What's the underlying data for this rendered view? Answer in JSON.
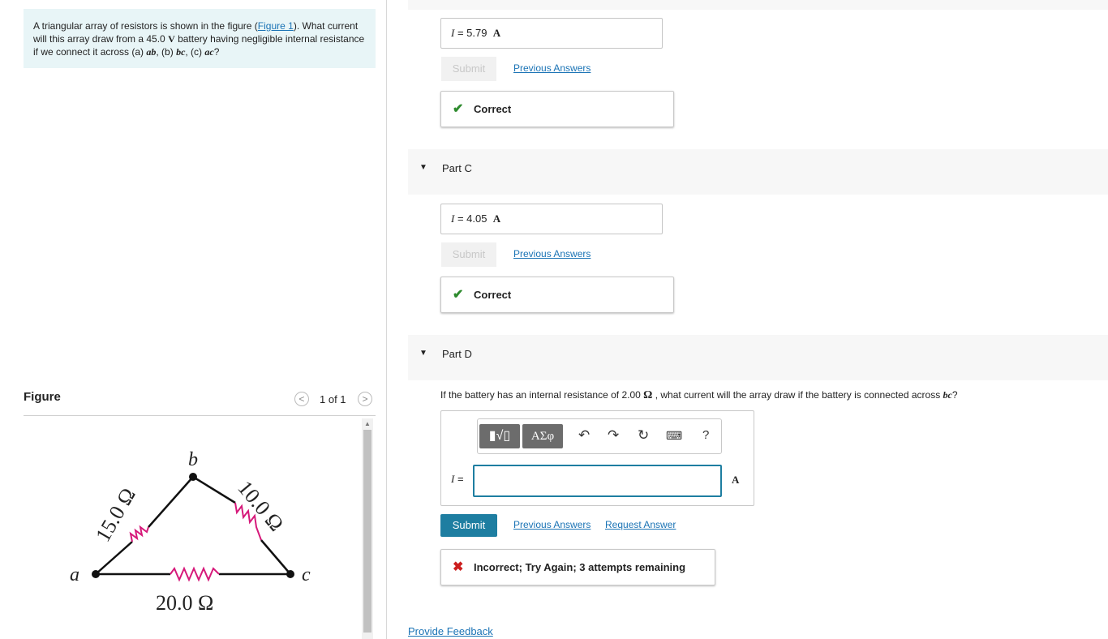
{
  "problem": {
    "text_1": "A triangular array of resistors is shown in the figure (",
    "figure_link": "Figure 1",
    "text_2": "). What current will this array draw from a 45.0 ",
    "unit_v": "V",
    "text_3": " battery having negligible internal resistance if we connect it across (a) ",
    "ab": "ab",
    "text_4": ", (b) ",
    "bc": "bc",
    "text_5": ", (c) ",
    "ac": "ac",
    "text_6": "?"
  },
  "figure": {
    "title": "Figure",
    "pager": "1 of 1",
    "prev": "<",
    "next": ">",
    "node_a": "a",
    "node_b": "b",
    "node_c": "c",
    "r_ab": "15.0 Ω",
    "r_bc": "10.0 Ω",
    "r_ac": "20.0 Ω",
    "colors": {
      "resistor": "#d6197a",
      "wire": "#111111"
    }
  },
  "part_b": {
    "var": "I",
    "eq": " = ",
    "value": "5.79",
    "unit": "A",
    "submit_label": "Submit",
    "previous_answers": "Previous Answers",
    "feedback": "Correct"
  },
  "part_c": {
    "title": "Part C",
    "var": "I",
    "eq": " = ",
    "value": "4.05",
    "unit": "A",
    "submit_label": "Submit",
    "previous_answers": "Previous Answers",
    "feedback": "Correct"
  },
  "part_d": {
    "title": "Part D",
    "question_1": "If the battery has an internal resistance of 2.00 ",
    "omega": "Ω",
    "question_2": " , what current will the array draw if the battery is connected across ",
    "bc": "bc",
    "question_3": "?",
    "toolbar": {
      "templates": "▮√▯",
      "greek": "ΑΣφ",
      "help": "?"
    },
    "var": "I",
    "eq": " =",
    "unit": "A",
    "input_value": "",
    "submit_label": "Submit",
    "previous_answers": "Previous Answers",
    "request_answer": "Request Answer",
    "feedback": "Incorrect; Try Again; 3 attempts remaining"
  },
  "footer": {
    "provide_feedback": "Provide Feedback"
  },
  "colors": {
    "accent": "#1e7ea1",
    "link": "#1a73b5",
    "correct": "#2e8b2e",
    "incorrect": "#cc1f1f",
    "problem_bg": "#e8f5f7"
  }
}
